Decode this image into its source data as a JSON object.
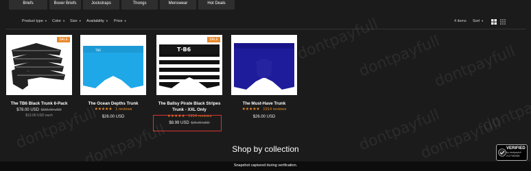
{
  "nav": {
    "tabs": [
      "Briefs",
      "Boxer Briefs",
      "Jockstraps",
      "Thongs",
      "Menswear",
      "Hot Deals"
    ]
  },
  "filters": {
    "labels": [
      "Product type",
      "Color",
      "Size",
      "Availability",
      "Price"
    ]
  },
  "toolbar": {
    "items_count": "4 items",
    "sort_label": "Sort"
  },
  "products": [
    {
      "name": "The TB6 Black Trunk 6-Pack",
      "sale_badge": "SALE",
      "price": "$78.00 USD",
      "compare_price": "$156.00 USD",
      "unit_price": "$13.00 USD each"
    },
    {
      "name": "The Ocean Depths Trunk",
      "stars": "★★★★★",
      "reviews": "1 reviews",
      "price": "$26.00 USD"
    },
    {
      "name": "The Ballsy Pirate Black Stripes Trunk - XXL Only",
      "sale_badge": "SALE",
      "stars": "★★★★★",
      "reviews": "1914 reviews",
      "price": "$8.99 USD",
      "compare_price": "$26.00 USD",
      "image_text": "T·B6"
    },
    {
      "name": "The Must-Have Trunk",
      "stars": "★★★★★",
      "reviews": "1914 reviews",
      "price": "$26.00 USD"
    }
  ],
  "collection_heading": "Shop by collection",
  "snapshot_text": "Snapshot captured during verification.",
  "verified_badge": {
    "title": "VERIFIED",
    "subtitle": "by dontpayfull",
    "id": "#127582666"
  },
  "watermark": "dontpayfull",
  "colors": {
    "accent": "#e8892a",
    "background": "#1b1b1b",
    "highlight_border": "#dd3333"
  }
}
